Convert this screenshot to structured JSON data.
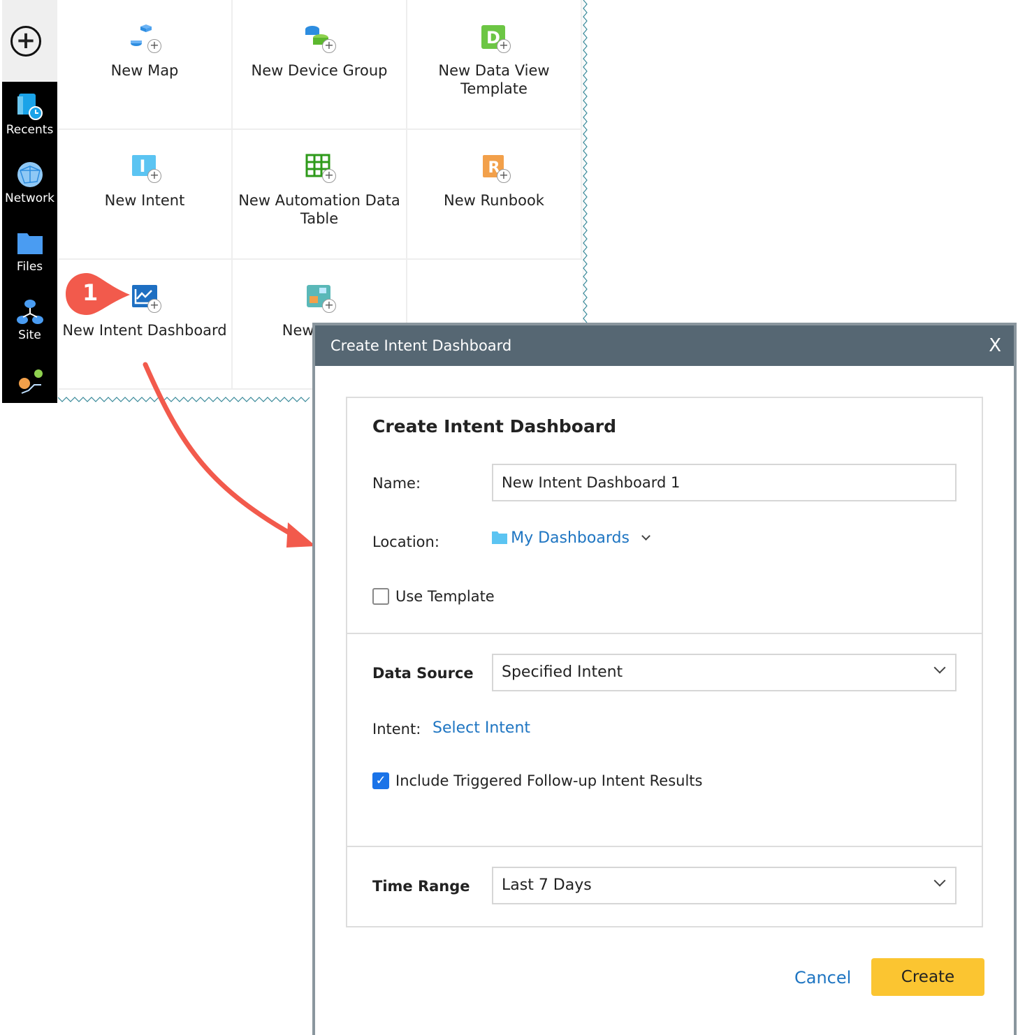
{
  "sidebar": {
    "add_label": "+",
    "items": [
      {
        "label": "Recents"
      },
      {
        "label": "Network"
      },
      {
        "label": "Files"
      },
      {
        "label": "Site"
      },
      {
        "label": ""
      }
    ]
  },
  "tiles": [
    {
      "label": "New Map",
      "icon": "map-icon"
    },
    {
      "label": "New Device Group",
      "icon": "device-group-icon"
    },
    {
      "label": "New Data View Template",
      "icon": "data-view-icon"
    },
    {
      "label": "New Intent",
      "icon": "intent-icon"
    },
    {
      "label": "New Automation Data Table",
      "icon": "table-icon"
    },
    {
      "label": "New Runbook",
      "icon": "runbook-icon"
    },
    {
      "label": "New Intent Dashboard",
      "icon": "dashboard-icon"
    },
    {
      "label": "New Netw",
      "icon": "network-icon"
    }
  ],
  "callout": {
    "number": "1",
    "color": "#f25a4c"
  },
  "dialog": {
    "title": "Create Intent Dashboard",
    "close": "X",
    "heading": "Create Intent Dashboard",
    "name_label": "Name:",
    "name_value": "New Intent Dashboard 1",
    "location_label": "Location:",
    "location_value": "My Dashboards",
    "use_template_label": "Use Template",
    "use_template_checked": false,
    "data_source_label": "Data Source",
    "data_source_value": "Specified Intent",
    "intent_label": "Intent:",
    "intent_link": "Select Intent",
    "include_label": "Include Triggered Follow-up Intent Results",
    "include_checked": true,
    "time_range_label": "Time Range",
    "time_range_value": "Last 7 Days",
    "cancel": "Cancel",
    "create": "Create"
  },
  "colors": {
    "header": "#566773",
    "accent": "#1e75c2",
    "create": "#fbc531"
  }
}
